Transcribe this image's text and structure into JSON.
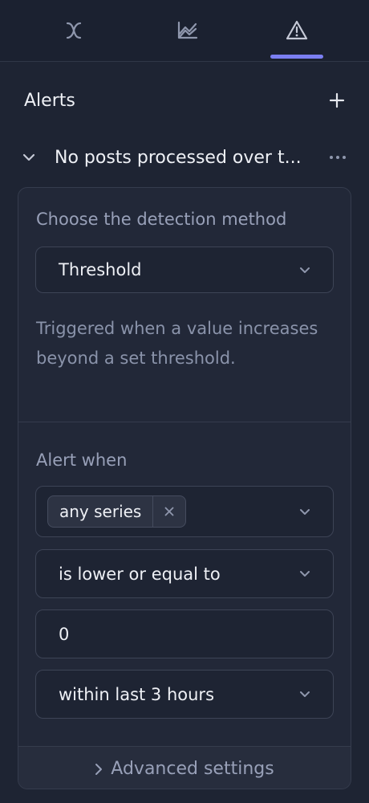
{
  "tabs": [
    {
      "icon": "function-x-icon",
      "active": false
    },
    {
      "icon": "area-chart-icon",
      "active": false
    },
    {
      "icon": "warning-triangle-icon",
      "active": true
    }
  ],
  "colors": {
    "accent": "#7b7ff2",
    "background": "#1e2433",
    "muted_text": "#8a93aa"
  },
  "panel": {
    "title": "Alerts",
    "add_icon": "plus-icon"
  },
  "alert": {
    "name": "No posts processed over t...",
    "detection_label": "Choose the detection method",
    "method": "Threshold",
    "description": "Triggered when a value increases beyond a set threshold.",
    "alert_when_label": "Alert when",
    "series_chip": "any series",
    "condition": "is lower or equal to",
    "value": "0",
    "window": "within last 3 hours",
    "advanced_label": "Advanced settings"
  }
}
